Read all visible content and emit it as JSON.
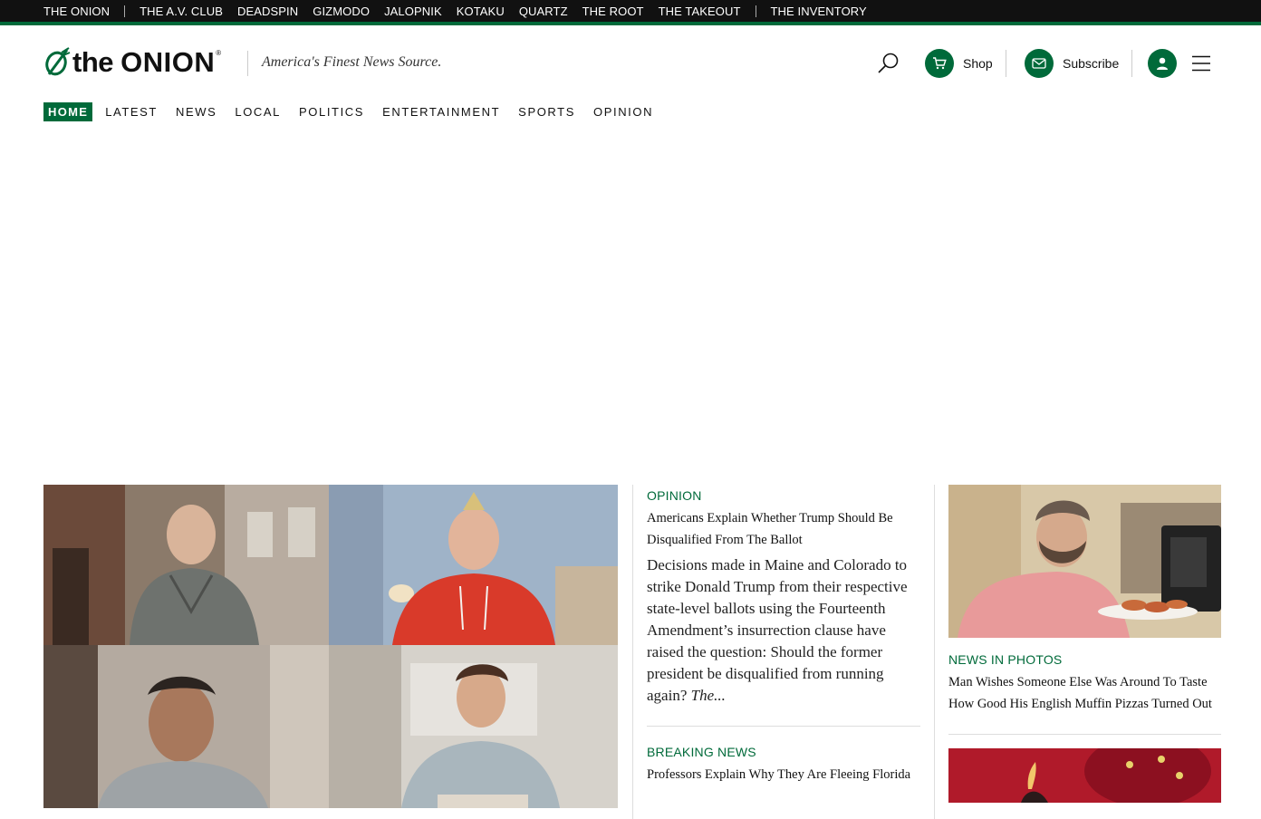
{
  "network_bar": {
    "links": [
      "THE ONION",
      "THE A.V. CLUB",
      "DEADSPIN",
      "GIZMODO",
      "JALOPNIK",
      "KOTAKU",
      "QUARTZ",
      "THE ROOT",
      "THE TAKEOUT",
      "THE INVENTORY"
    ]
  },
  "header": {
    "logo_the": "the",
    "logo_onion": "ONION",
    "logo_reg": "®",
    "tagline": "America's Finest News Source.",
    "shop_label": "Shop",
    "subscribe_label": "Subscribe"
  },
  "section_nav": {
    "items": [
      "HOME",
      "LATEST",
      "NEWS",
      "LOCAL",
      "POLITICS",
      "ENTERTAINMENT",
      "SPORTS",
      "OPINION"
    ],
    "active": "HOME"
  },
  "feature": {
    "kicker": "OPINION",
    "headline": "Americans Explain Whether Trump Should Be Disqualified From The Ballot",
    "dek": "Decisions made in Maine and Colorado to strike Donald Trump from their respective state-level ballots using the Fourteenth Amendment’s insurrection clause have raised the question: Should the former president be disqualified from running again?",
    "dek_more": "The..."
  },
  "breaking": {
    "kicker": "BREAKING NEWS",
    "headline": "Professors Explain Why They Are Fleeing Florida"
  },
  "photos_story": {
    "kicker": "NEWS IN PHOTOS",
    "headline": "Man Wishes Someone Else Was Around To Taste How Good His English Muffin Pizzas Turned Out"
  },
  "colors": {
    "brand_green": "#006a3a",
    "network_bar": "#111111"
  }
}
